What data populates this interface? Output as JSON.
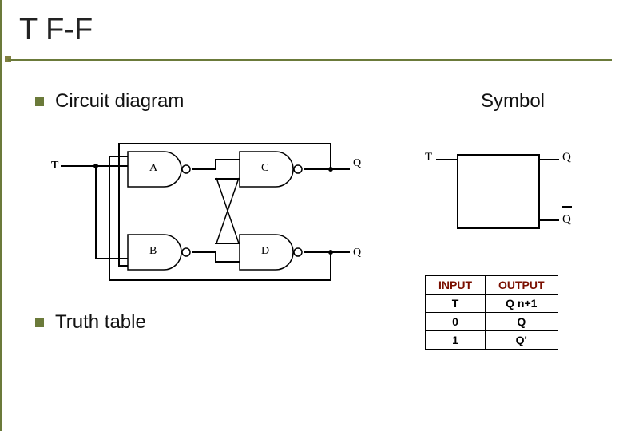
{
  "title": "T F-F",
  "headings": {
    "circuit": "Circuit diagram",
    "symbol": "Symbol",
    "truth": "Truth table"
  },
  "circuit": {
    "input": "T",
    "gates": {
      "A": "A",
      "B": "B",
      "C": "C",
      "D": "D"
    },
    "outputs": {
      "Q": "Q",
      "Qbar": "Q"
    }
  },
  "symbol": {
    "input": "T",
    "outQ": "Q",
    "outQbar": "Q"
  },
  "truth_table": {
    "headers": [
      "INPUT",
      "OUTPUT"
    ],
    "sub": [
      "T",
      "Q n+1"
    ],
    "rows": [
      [
        "0",
        "Q"
      ],
      [
        "1",
        "Q'"
      ]
    ]
  }
}
